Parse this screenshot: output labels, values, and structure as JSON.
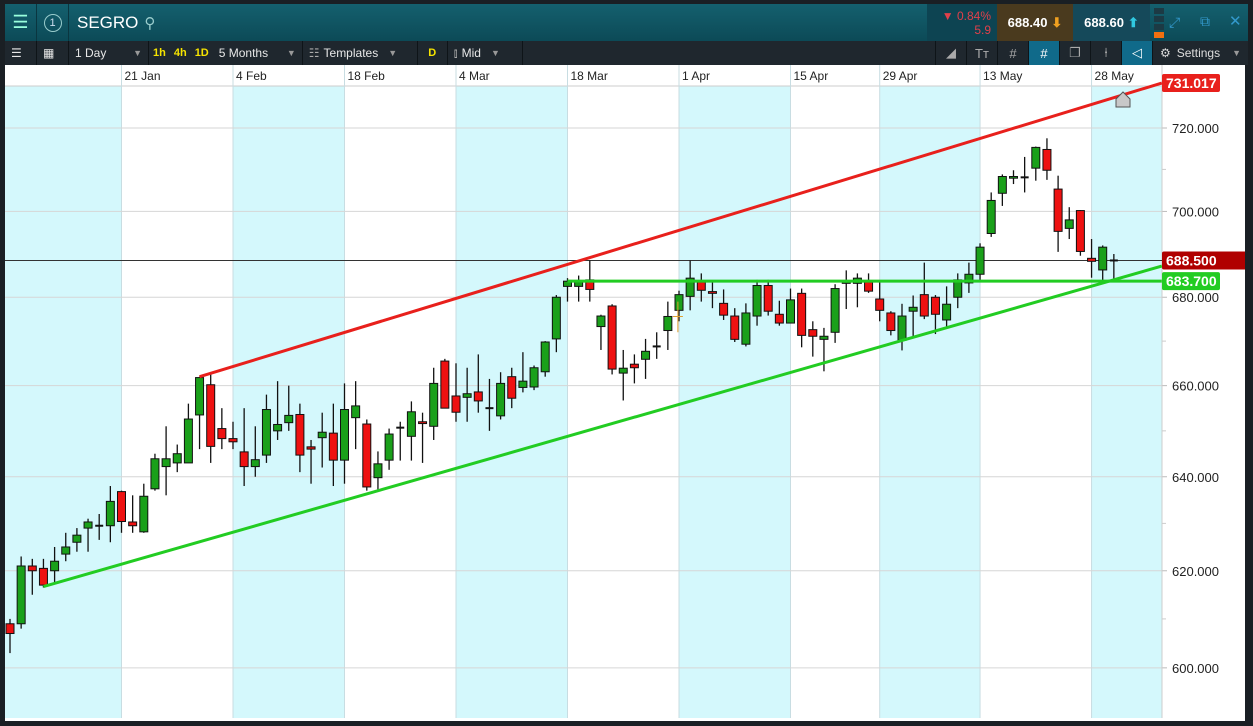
{
  "header": {
    "symbol": "SEGRO",
    "badge": "1",
    "change_pct": "▼ 0.84%",
    "change_abs": "5.9",
    "sell": "688.40",
    "buy": "688.60"
  },
  "toolbar": {
    "interval": "1 Day",
    "quick": [
      "1h",
      "4h",
      "1D"
    ],
    "range": "5 Months",
    "templates": "Templates",
    "d": "D",
    "price_type": "Mid",
    "settings": "Settings"
  },
  "colors": {
    "up": "#1aa01a",
    "down": "#ee1111",
    "resistance": "#e8201c",
    "support": "#22cc22",
    "band": "#d4f8fc"
  },
  "chart_data": {
    "type": "candlestick",
    "x_tick_labels": [
      "21 Jan",
      "4 Feb",
      "18 Feb",
      "4 Mar",
      "18 Mar",
      "1 Apr",
      "15 Apr",
      "29 Apr",
      "13 May",
      "28 May"
    ],
    "x_tick_index": [
      10,
      20,
      30,
      40,
      50,
      60,
      70,
      78,
      87,
      97
    ],
    "y_ticks": [
      600,
      620,
      640,
      660,
      680,
      700,
      720
    ],
    "y_tick_labels": [
      "600.000",
      "620.000",
      "640.000",
      "660.000",
      "680.000",
      "700.000",
      "720.000"
    ],
    "ylim": [
      595,
      735
    ],
    "scale": "log",
    "current_price": 688.5,
    "labels": [
      {
        "text": "731.017",
        "value": 731.017,
        "color": "#e8201c"
      },
      {
        "text": "688.500",
        "value": 688.5,
        "color": "#b00000"
      },
      {
        "text": "683.700",
        "value": 683.7,
        "color": "#22cc22"
      }
    ],
    "trendlines": [
      {
        "name": "resistance",
        "from": [
          17,
          662
        ],
        "to": [
          103.3,
          731.017
        ],
        "color": "#e8201c"
      },
      {
        "name": "support",
        "from": [
          3,
          616.7
        ],
        "to": [
          103.3,
          687.2
        ],
        "color": "#22cc22"
      },
      {
        "name": "horizontal-support",
        "from": [
          50,
          683.7
        ],
        "to": [
          103.3,
          683.7
        ],
        "color": "#22cc22"
      }
    ],
    "ohlc": [
      [
        609,
        610,
        603,
        607
      ],
      [
        609,
        623,
        608,
        621
      ],
      [
        621,
        622.5,
        615,
        620
      ],
      [
        620.5,
        622.5,
        616.5,
        617
      ],
      [
        620,
        625,
        617.5,
        622
      ],
      [
        623.5,
        628,
        622,
        625
      ],
      [
        626,
        629,
        624,
        627.5
      ],
      [
        629,
        631,
        624,
        630.3
      ],
      [
        629.5,
        632,
        626.5,
        629.5
      ],
      [
        629.5,
        638,
        626,
        634.7
      ],
      [
        636.8,
        637,
        628,
        630.4
      ],
      [
        630.3,
        636,
        628,
        629.5
      ],
      [
        628.2,
        638.5,
        628,
        635.8
      ],
      [
        637.4,
        645,
        637,
        643.9
      ],
      [
        642.2,
        651,
        636,
        643.9
      ],
      [
        643,
        647,
        641,
        645
      ],
      [
        643,
        656,
        643,
        652.6
      ],
      [
        653.5,
        662,
        646,
        661.8
      ],
      [
        660.2,
        663,
        643,
        646.6
      ],
      [
        650.5,
        655,
        646,
        648.3
      ],
      [
        648.3,
        652,
        646,
        647.6
      ],
      [
        645.4,
        655,
        638,
        642.2
      ],
      [
        642.2,
        651,
        640,
        643.7
      ],
      [
        644.7,
        658,
        643,
        654.7
      ],
      [
        650,
        661,
        648,
        651.4
      ],
      [
        651.8,
        660,
        650,
        653.4
      ],
      [
        653.6,
        656,
        641,
        644.7
      ],
      [
        646.5,
        648,
        638.5,
        646
      ],
      [
        648.5,
        654,
        642,
        649.7
      ],
      [
        649.5,
        656,
        638,
        643.6
      ],
      [
        643.6,
        660.5,
        638.5,
        654.7
      ],
      [
        652.9,
        661,
        646,
        655.5
      ],
      [
        651.5,
        652.5,
        637,
        637.8
      ],
      [
        639.8,
        645.5,
        637,
        642.8
      ],
      [
        643.6,
        650.5,
        641.5,
        649.3
      ],
      [
        650.6,
        652,
        643.5,
        650.7
      ],
      [
        648.8,
        656.5,
        643.5,
        654.2
      ],
      [
        652,
        654,
        643,
        651.6
      ],
      [
        651,
        664,
        648,
        660.5
      ],
      [
        665.5,
        666,
        655,
        655
      ],
      [
        657.7,
        665,
        652,
        654.1
      ],
      [
        657.4,
        664,
        652,
        658.2
      ],
      [
        658.6,
        667,
        654,
        656.6
      ],
      [
        655,
        661.5,
        650,
        655
      ],
      [
        653.3,
        663,
        652.5,
        660.5
      ],
      [
        662,
        664,
        655,
        657.2
      ],
      [
        659.6,
        667.5,
        658.5,
        661
      ],
      [
        659.7,
        664.5,
        659,
        664
      ],
      [
        663.1,
        670,
        662,
        669.8
      ],
      [
        670.5,
        680.5,
        667.5,
        680
      ],
      [
        682.5,
        684.4,
        679,
        683.7
      ],
      [
        682.5,
        685,
        679,
        683.5
      ],
      [
        684,
        688.5,
        679,
        681.8
      ],
      [
        673.3,
        676,
        668,
        675.7
      ],
      [
        678,
        678.4,
        662.5,
        663.7
      ],
      [
        662.8,
        668,
        656.7,
        663.9
      ],
      [
        664.8,
        667,
        660.5,
        664
      ],
      [
        665.9,
        670.5,
        661.5,
        667.7
      ],
      [
        668.7,
        672,
        666,
        668.8
      ],
      [
        672.4,
        679,
        668,
        675.6
      ],
      [
        677,
        681.5,
        674.5,
        680.6
      ],
      [
        680.2,
        688.5,
        677,
        684.4
      ],
      [
        683.5,
        685.5,
        679,
        681.6
      ],
      [
        681.3,
        683.8,
        677.5,
        680.9
      ],
      [
        678.6,
        681.8,
        674.8,
        675.9
      ],
      [
        675.7,
        677.5,
        669.8,
        670.4
      ],
      [
        669.3,
        678.6,
        668.8,
        676.4
      ],
      [
        675.7,
        684,
        673.5,
        682.7
      ],
      [
        682.7,
        684,
        675.8,
        676.8
      ],
      [
        676.1,
        679.2,
        673.5,
        674.1
      ],
      [
        674.1,
        682,
        674,
        679.4
      ],
      [
        680.9,
        682,
        668.6,
        671.3
      ],
      [
        672.6,
        674.5,
        666.5,
        671.1
      ],
      [
        670.4,
        673,
        663.2,
        671.1
      ],
      [
        672,
        683,
        669.6,
        682
      ],
      [
        683.2,
        686.2,
        677.3,
        683.8
      ],
      [
        683.2,
        685.5,
        677.7,
        684.4
      ],
      [
        683.5,
        685.5,
        681,
        681.4
      ],
      [
        679.6,
        683.5,
        674.5,
        677
      ],
      [
        676.4,
        676.8,
        671.3,
        672.4
      ],
      [
        670.2,
        678.5,
        667.9,
        675.7
      ],
      [
        676.8,
        680.4,
        670.8,
        677.7
      ],
      [
        680.6,
        688,
        675,
        675.7
      ],
      [
        680,
        680.5,
        671.6,
        676.1
      ],
      [
        674.8,
        682.5,
        672.8,
        678.4
      ],
      [
        680,
        685.5,
        677.5,
        684
      ],
      [
        683.3,
        688,
        681,
        685.3
      ],
      [
        685.3,
        692.5,
        684,
        691.6
      ],
      [
        694.8,
        704.5,
        694,
        702.6
      ],
      [
        704.3,
        708.8,
        701.3,
        708.3
      ],
      [
        707.9,
        709.8,
        706.5,
        708.3
      ],
      [
        708.1,
        713,
        704.5,
        708.1
      ],
      [
        710.3,
        715.5,
        707.3,
        715.3
      ],
      [
        714.8,
        717.5,
        707.5,
        709.8
      ],
      [
        705.3,
        708.5,
        690.5,
        695.3
      ],
      [
        696,
        701,
        693.5,
        698
      ],
      [
        700.2,
        700.3,
        689.6,
        690.6
      ],
      [
        689,
        693.5,
        684.5,
        688.3
      ],
      [
        686.3,
        692,
        683.5,
        691.6
      ],
      [
        688.5,
        690,
        684,
        688.5
      ]
    ]
  }
}
